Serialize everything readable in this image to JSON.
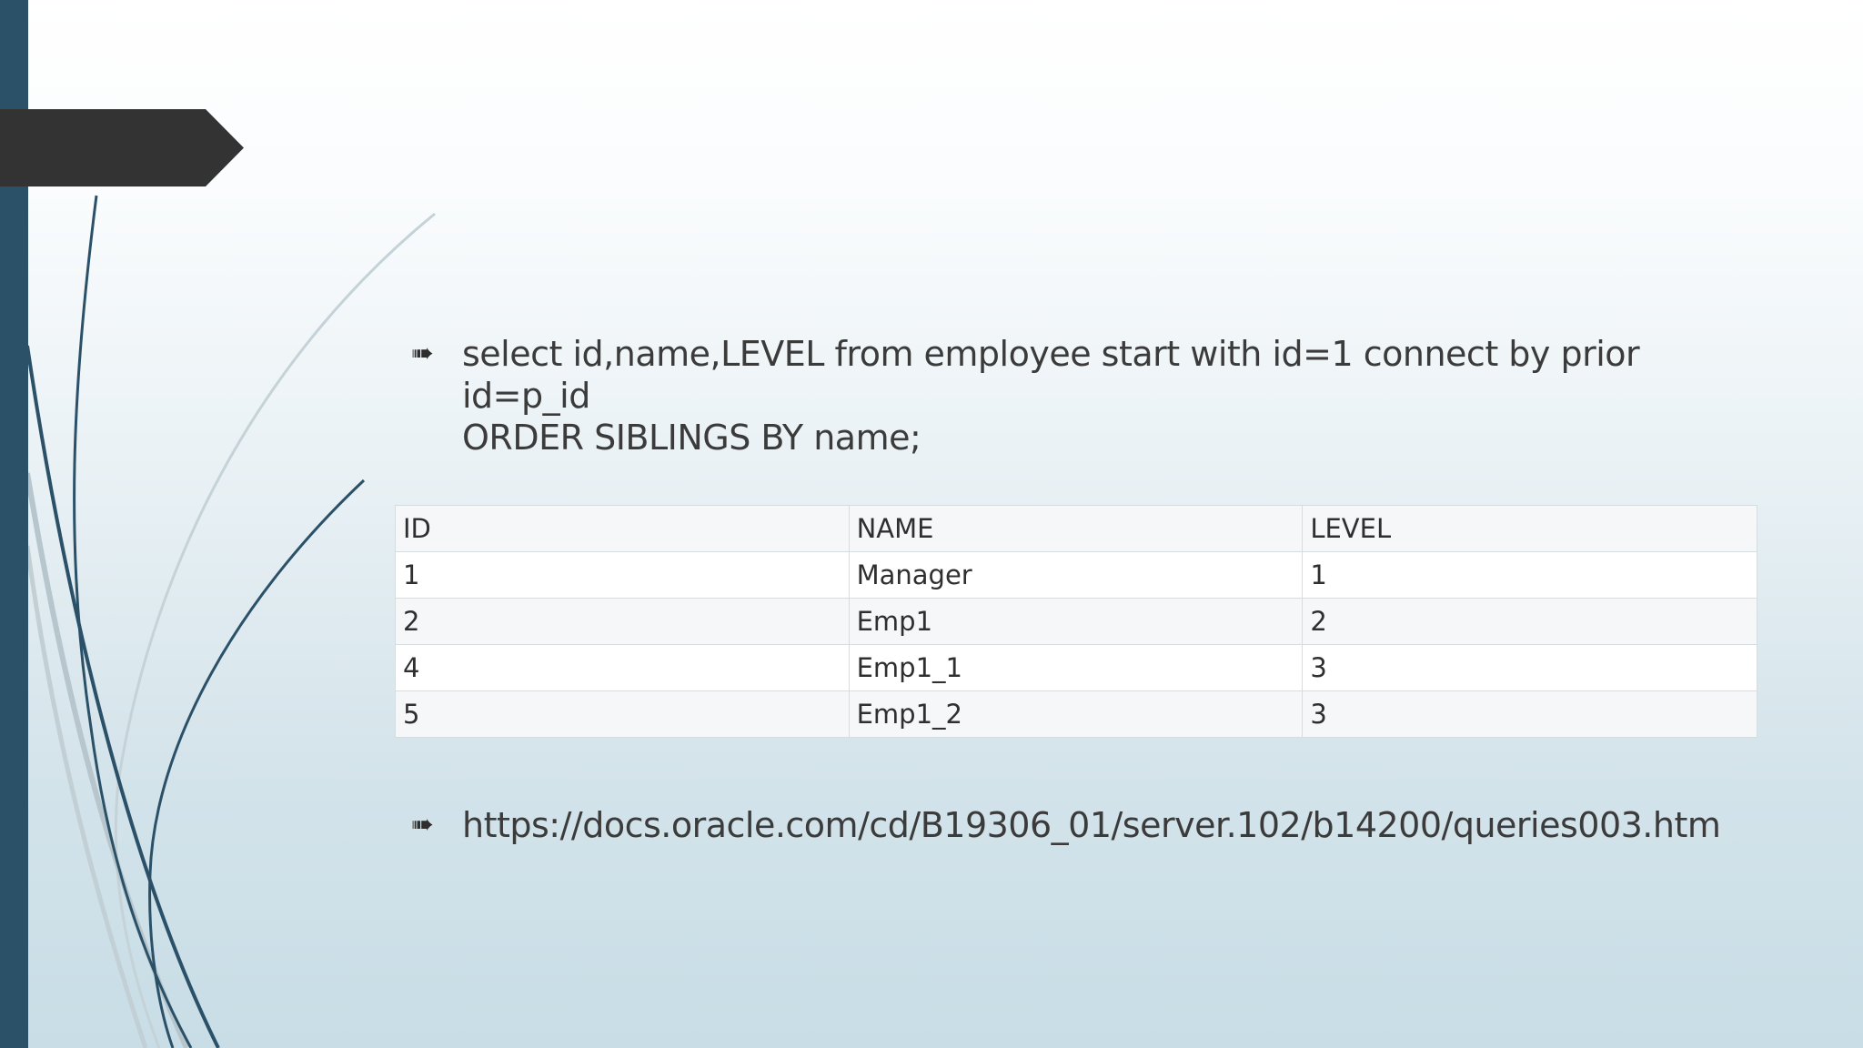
{
  "slide": {
    "colors": {
      "left_bar": "#2b5168",
      "title_tab": "#333333",
      "accent_line_dark": "#2b5168",
      "accent_line_light": "#b9c8ce"
    },
    "bullets": [
      {
        "icon": "arrow-bullet-icon",
        "line1": "select id,name,LEVEL from employee start with id=1 connect by prior id=p_id",
        "line2": "ORDER SIBLINGS BY name;"
      },
      {
        "icon": "arrow-bullet-icon",
        "line1": "https://docs.oracle.com/cd/B19306_01/server.102/b14200/queries003.htm"
      }
    ],
    "table": {
      "headers": [
        "ID",
        "NAME",
        "LEVEL"
      ],
      "rows": [
        [
          "1",
          "Manager",
          "1"
        ],
        [
          "2",
          "Emp1",
          "2"
        ],
        [
          "4",
          "Emp1_1",
          "3"
        ],
        [
          "5",
          "Emp1_2",
          "3"
        ]
      ]
    }
  }
}
